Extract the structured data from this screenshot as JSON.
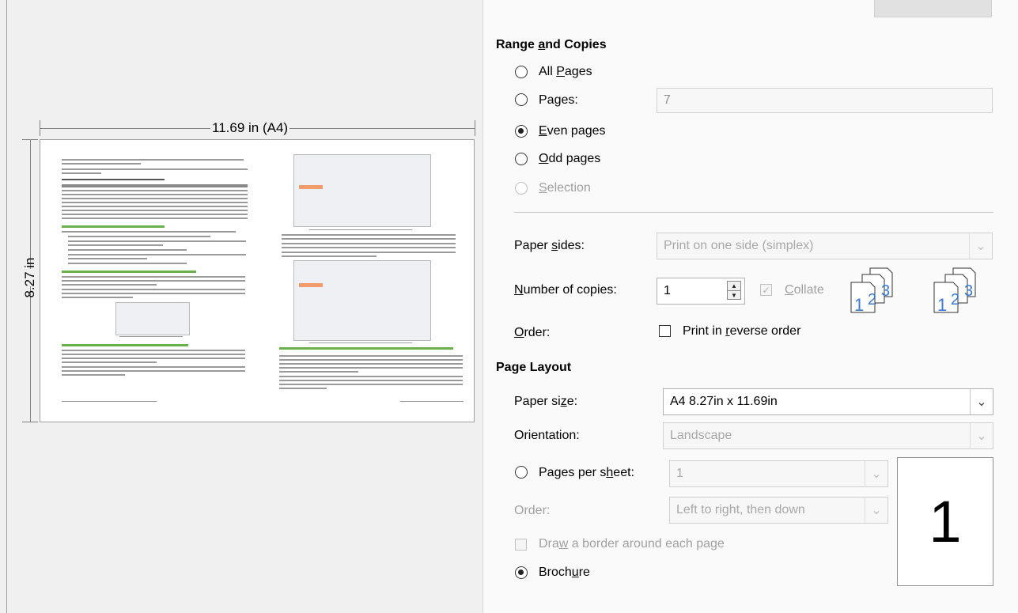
{
  "preview": {
    "width_label": "11.69 in (A4)",
    "height_label": "8.27 in"
  },
  "range_and_copies": {
    "title_pre": "Range ",
    "title_u": "a",
    "title_post": "nd Copies",
    "all_pages": {
      "pre": "All ",
      "u": "P",
      "post": "ages"
    },
    "pages": {
      "pre": "Pa",
      "u": "g",
      "post": "es:",
      "value": "7"
    },
    "even_pages": {
      "pre": "",
      "u": "E",
      "post": "ven pages"
    },
    "odd_pages": {
      "pre": "",
      "u": "O",
      "post": "dd pages"
    },
    "selection": {
      "pre": "",
      "u": "S",
      "post": "election"
    },
    "selected": "even_pages"
  },
  "paper_sides": {
    "pre": "Paper ",
    "u": "s",
    "post": "ides:",
    "value": "Print on one side (simplex)"
  },
  "copies": {
    "pre": "",
    "u": "N",
    "post": "umber of copies:",
    "value": "1"
  },
  "collate": {
    "pre": "",
    "u": "C",
    "post": "ollate",
    "checked": true
  },
  "order": {
    "pre": "",
    "u": "O",
    "post": "rder:",
    "reverse_pre": "Print in ",
    "reverse_u": "r",
    "reverse_post": "everse order",
    "reverse_checked": false
  },
  "page_layout": {
    "title": "Page Layout",
    "paper_size": {
      "pre": "Paper si",
      "u": "z",
      "post": "e:",
      "value": "A4 8.27in x 11.69in"
    },
    "orientation": {
      "label": "Orientation:",
      "value": "Landscape"
    },
    "pages_per_sheet": {
      "pre": "Pages per s",
      "u": "h",
      "post": "eet:",
      "value": "1"
    },
    "order": {
      "label": "Order:",
      "value": "Left to right, then down"
    },
    "border": {
      "pre": "Dra",
      "u": "w",
      "post": " a border around each page",
      "checked": false
    },
    "brochure": {
      "pre": "Broch",
      "u": "u",
      "post": "re",
      "checked": true
    },
    "preview_number": "1"
  },
  "collate_icons": {
    "n1": "1",
    "n2": "2",
    "n3": "3"
  },
  "icons": {
    "dropdown": "chevron-down-icon",
    "spin_up": "triangle-up-icon",
    "spin_down": "triangle-down-icon"
  }
}
